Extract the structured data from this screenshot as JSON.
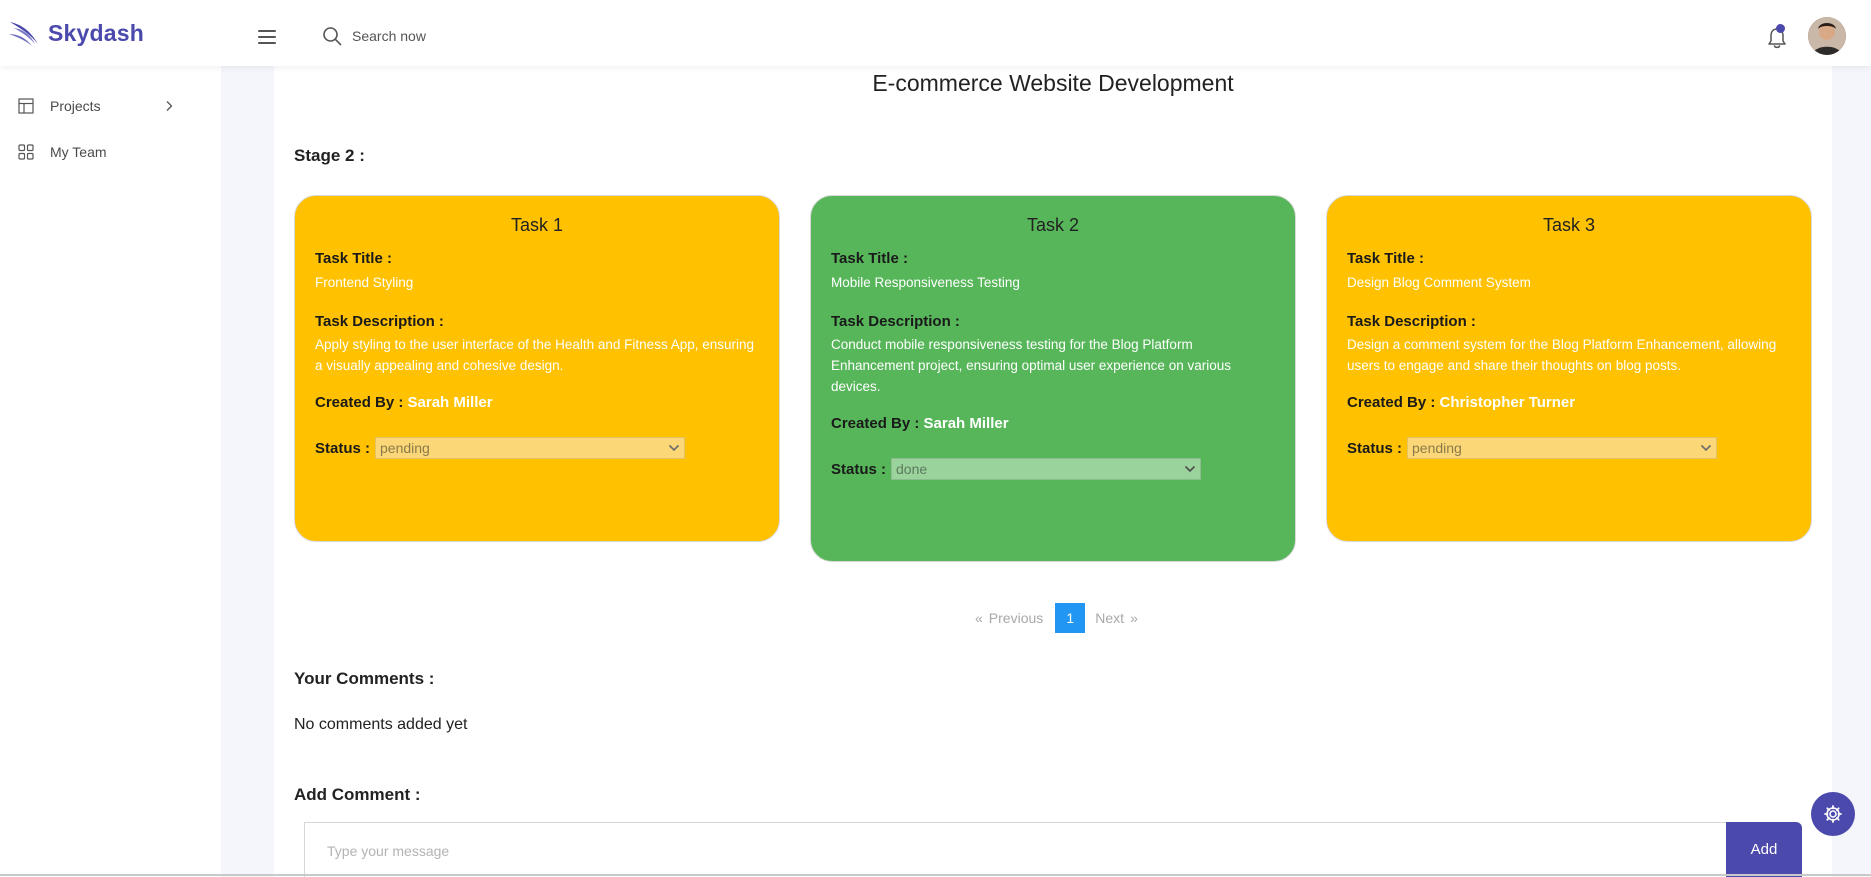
{
  "app": {
    "name": "Skydash",
    "brand_color": "#4b49ac"
  },
  "topbar": {
    "search_placeholder": "Search now",
    "icons": [
      "menu-icon",
      "search-icon",
      "bell-icon"
    ]
  },
  "sidebar": {
    "items": [
      {
        "label": "Projects",
        "icon": "layout-icon",
        "has_chevron": true
      },
      {
        "label": "My Team",
        "icon": "grid-icon"
      }
    ]
  },
  "project": {
    "title": "E-commerce Website Development",
    "stage_label": "Stage 2 :"
  },
  "labels": {
    "task_title": "Task Title :",
    "task_description": "Task Description :",
    "created_by": "Created By :",
    "status": "Status :"
  },
  "tasks": [
    {
      "heading": "Task 1",
      "title": "Frontend Styling",
      "description": "Apply styling to the user interface of the Health and Fitness App, ensuring a visually appealing and cohesive design.",
      "created_by": "Sarah Miller",
      "status": "pending",
      "color": "#ffc100"
    },
    {
      "heading": "Task 2",
      "title": "Mobile Responsiveness Testing",
      "description": "Conduct mobile responsiveness testing for the Blog Platform Enhancement project, ensuring optimal user experience on various devices.",
      "created_by": "Sarah Miller",
      "status": "done",
      "color": "#57b65a"
    },
    {
      "heading": "Task 3",
      "title": "Design Blog Comment System",
      "description": "Design a comment system for the Blog Platform Enhancement, allowing users to engage and share their thoughts on blog posts.",
      "created_by": "Christopher Turner",
      "status": "pending",
      "color": "#ffc100"
    }
  ],
  "pagination": {
    "prev_symbol": "«",
    "prev": "Previous",
    "current": "1",
    "next": "Next",
    "next_symbol": "»",
    "active_color": "#2196f3"
  },
  "comments": {
    "your_heading": "Your Comments :",
    "empty_text": "No comments added yet",
    "add_heading": "Add Comment :",
    "placeholder": "Type your message",
    "add_button": "Add"
  }
}
